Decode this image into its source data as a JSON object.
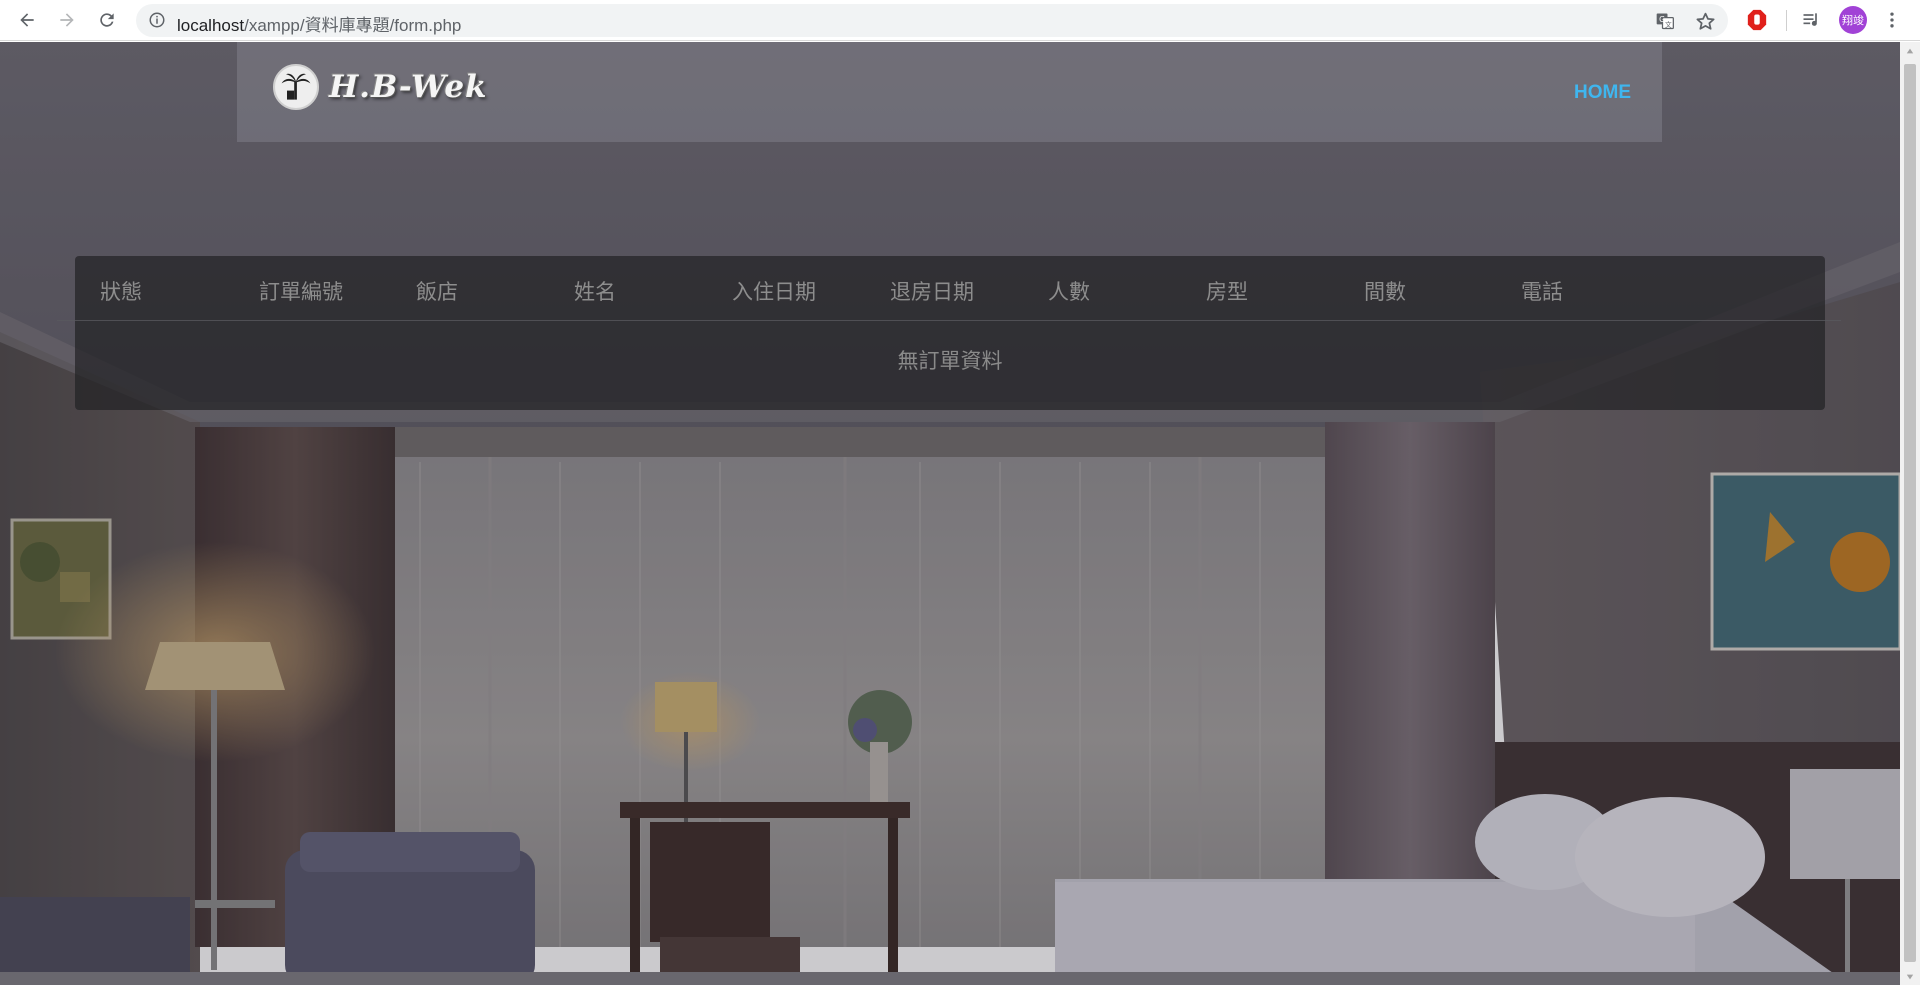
{
  "browser": {
    "url_host": "localhost",
    "url_path": "/xampp/資料庫專題/form.php",
    "profile_initials": "翔竣"
  },
  "site": {
    "logo_text": "H.B-Wek",
    "nav_home": "HOME",
    "accent_color": "#3fb6ef"
  },
  "order_table": {
    "headers": [
      "狀態",
      "訂單編號",
      "飯店",
      "姓名",
      "入住日期",
      "退房日期",
      "人數",
      "房型",
      "間數",
      "電話"
    ],
    "empty_message": "無訂單資料"
  }
}
